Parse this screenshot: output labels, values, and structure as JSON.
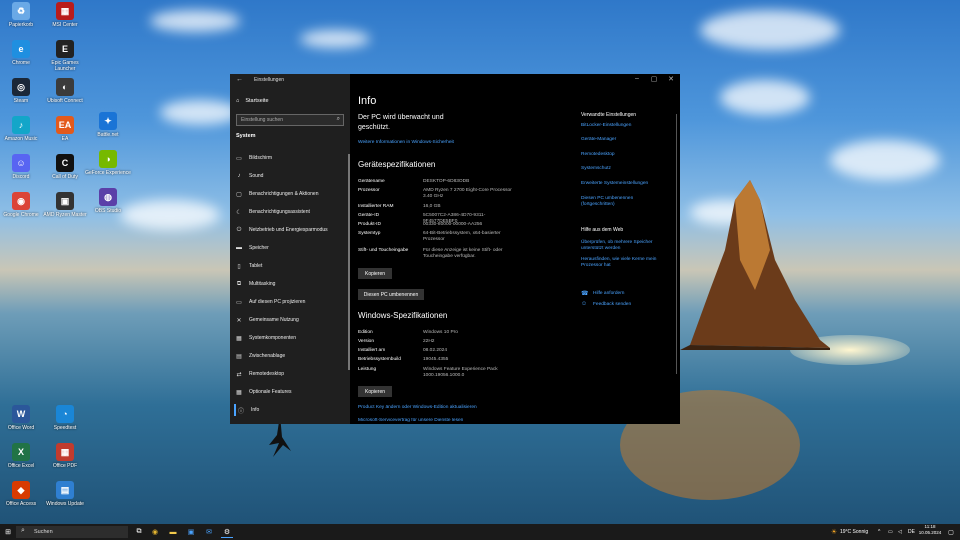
{
  "desktop": {
    "icons_left": [
      {
        "label": "Papierkorb",
        "icon": "recycle-bin-icon",
        "color": "#6aa9e6",
        "glyph": "♻"
      },
      {
        "label": "Chrome",
        "icon": "edge-icon",
        "color": "#1f8fe0",
        "glyph": "e"
      },
      {
        "label": "Steam",
        "icon": "steam-icon",
        "color": "#1b2838",
        "glyph": "◎"
      },
      {
        "label": "Amazon Music",
        "icon": "amazon-music-icon",
        "color": "#13a6c9",
        "glyph": "♪"
      },
      {
        "label": "Discord",
        "icon": "discord-icon",
        "color": "#5865f2",
        "glyph": "☺"
      },
      {
        "label": "Google Chrome",
        "icon": "chrome-icon",
        "color": "#db4437",
        "glyph": "◉"
      }
    ],
    "icons_col2": [
      {
        "label": "MSI Center",
        "icon": "msi-icon",
        "color": "#b91c1c",
        "glyph": "▦"
      },
      {
        "label": "Epic Games Launcher",
        "icon": "epic-games-icon",
        "color": "#222222",
        "glyph": "E"
      },
      {
        "label": "Ubisoft Connect",
        "icon": "ubisoft-icon",
        "color": "#3b3b3b",
        "glyph": "◐"
      },
      {
        "label": "EA",
        "icon": "ea-icon",
        "color": "#e35a1c",
        "glyph": "EA"
      },
      {
        "label": "Call of Duty",
        "icon": "cod-icon",
        "color": "#111111",
        "glyph": "C"
      },
      {
        "label": "AMD Ryzen Master",
        "icon": "amd-icon",
        "color": "#333333",
        "glyph": "▣"
      }
    ],
    "icons_col3": [
      {
        "label": "Battle.net",
        "icon": "battlenet-icon",
        "color": "#1a74d6",
        "glyph": "✦"
      },
      {
        "label": "GeForce Experience",
        "icon": "nvidia-icon",
        "color": "#76b900",
        "glyph": "◑"
      },
      {
        "label": "OBS Studio",
        "icon": "obs-icon",
        "color": "#5b3fa8",
        "glyph": "◍"
      }
    ],
    "icons_bottom": [
      {
        "label": "Office Word",
        "icon": "word-icon",
        "color": "#2b579a",
        "glyph": "W"
      },
      {
        "label": "Office Excel",
        "icon": "excel-icon",
        "color": "#217346",
        "glyph": "X"
      },
      {
        "label": "Office Access",
        "icon": "office-icon",
        "color": "#d83b01",
        "glyph": "◆"
      }
    ],
    "icons_bottom2": [
      {
        "label": "Speedtest",
        "icon": "speedtest-icon",
        "color": "#1a86d6",
        "glyph": "◔"
      },
      {
        "label": "Office PDF",
        "icon": "pdf-icon",
        "color": "#c13b2e",
        "glyph": "▦"
      },
      {
        "label": "Windows Update",
        "icon": "update-icon",
        "color": "#2f7fd1",
        "glyph": "▤"
      }
    ]
  },
  "window": {
    "title": "Einstellungen",
    "sidebar": {
      "home": "Startseite",
      "search_placeholder": "Einstellung suchen",
      "section": "System",
      "items": [
        {
          "label": "Bildschirm",
          "glyph": "▭",
          "name": "sidebar-item-display"
        },
        {
          "label": "Sound",
          "glyph": "♪",
          "name": "sidebar-item-sound"
        },
        {
          "label": "Benachrichtigungen & Aktionen",
          "glyph": "▢",
          "name": "sidebar-item-notifications"
        },
        {
          "label": "Benachrichtigungsassistent",
          "glyph": "☾",
          "name": "sidebar-item-focus"
        },
        {
          "label": "Netzbetrieb und Energiesparmodus",
          "glyph": "⏻",
          "name": "sidebar-item-power"
        },
        {
          "label": "Speicher",
          "glyph": "▬",
          "name": "sidebar-item-storage"
        },
        {
          "label": "Tablet",
          "glyph": "▯",
          "name": "sidebar-item-tablet"
        },
        {
          "label": "Multitasking",
          "glyph": "⧉",
          "name": "sidebar-item-multitasking"
        },
        {
          "label": "Auf diesen PC projizieren",
          "glyph": "▭",
          "name": "sidebar-item-project"
        },
        {
          "label": "Gemeinsame Nutzung",
          "glyph": "✕",
          "name": "sidebar-item-shared"
        },
        {
          "label": "Systemkomponenten",
          "glyph": "▦",
          "name": "sidebar-item-components"
        },
        {
          "label": "Zwischenablage",
          "glyph": "▤",
          "name": "sidebar-item-clipboard"
        },
        {
          "label": "Remotedesktop",
          "glyph": "⇄",
          "name": "sidebar-item-remote"
        },
        {
          "label": "Optionale Features",
          "glyph": "▦",
          "name": "sidebar-item-optional"
        },
        {
          "label": "Info",
          "glyph": "ⓘ",
          "name": "sidebar-item-info"
        }
      ]
    },
    "main": {
      "title": "Info",
      "monitor_heading": "Der PC wird überwacht und geschützt.",
      "monitor_link": "Weitere Informationen in Windows-Sicherheit",
      "device_heading": "Gerätespezifikationen",
      "device_specs": [
        {
          "k": "Gerätename",
          "v": "DESKTOP-6D83ODB"
        },
        {
          "k": "Prozessor",
          "v": "AMD Ryzen 7 2700 Eight-Core Processor 3.40 GHz"
        },
        {
          "k": "Installierter RAM",
          "v": "16,0 GB"
        },
        {
          "k": "Geräte-ID",
          "v": "5C5007C2-A386-4D70-9311-9F4577DE5BF0"
        },
        {
          "k": "Produkt-ID",
          "v": "00330-80000-00000-AA256"
        },
        {
          "k": "Systemtyp",
          "v": "64-Bit-Betriebssystem, x64-basierter Prozessor"
        },
        {
          "k": "Stift- und Toucheingabe",
          "v": "Für diese Anzeige ist keine Stift- oder Toucheingabe verfügbar."
        }
      ],
      "copy_button": "Kopieren",
      "rename_button": "Diesen PC umbenennen",
      "windows_heading": "Windows-Spezifikationen",
      "windows_specs": [
        {
          "k": "Edition",
          "v": "Windows 10 Pro"
        },
        {
          "k": "Version",
          "v": "22H2"
        },
        {
          "k": "Installiert am",
          "v": "08.02.2024"
        },
        {
          "k": "Betriebssystembuild",
          "v": "19045.4355"
        },
        {
          "k": "Leistung",
          "v": "Windows Feature Experience Pack 1000.19056.1000.0"
        }
      ],
      "copy_button2": "Kopieren",
      "product_key_link": "Product Key ändern oder Windows-Edition aktualisieren",
      "cut_link": "Microsoft-Servicevertrag für unsere Dienste lesen"
    },
    "related": {
      "heading": "Verwandte Einstellungen",
      "links": [
        "BitLocker-Einstellungen",
        "Geräte-Manager",
        "Remotedesktop",
        "Systemschutz",
        "Erweiterte Systemeinstellungen",
        "Diesen PC umbenennen (fortgeschritten)"
      ],
      "help_heading": "Hilfe aus dem Web",
      "help_links": [
        "Überprüfen, ob mehrere Speicher unterstützt werden",
        "Herausfinden, wie viele Kerne mein Prozessor hat"
      ],
      "get_help": "Hilfe anfordern",
      "feedback": "Feedback senden"
    }
  },
  "taskbar": {
    "search_placeholder": "Suchen",
    "weather": "19°C  Sonnig",
    "time": "11:18",
    "date": "10.05.2024"
  }
}
